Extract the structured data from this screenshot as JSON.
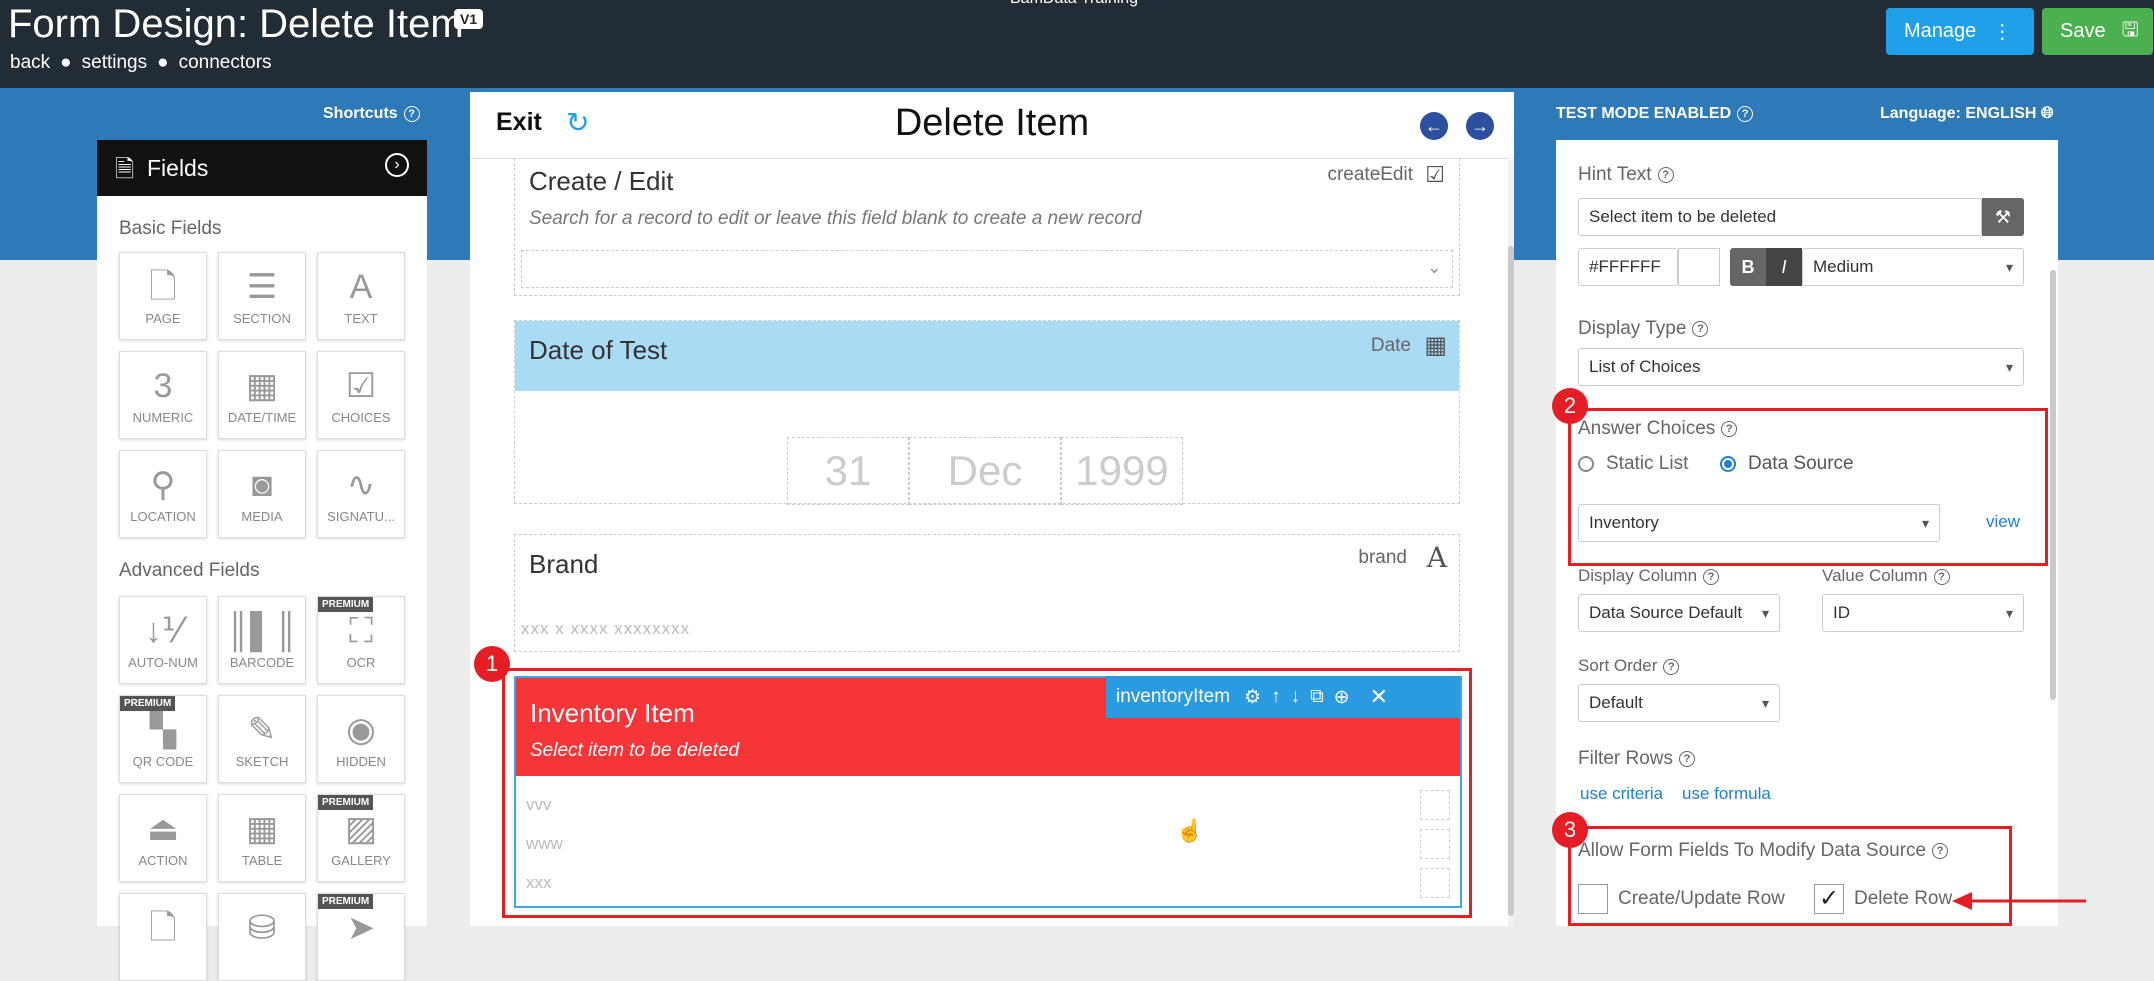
{
  "header": {
    "title": "Form Design: Delete Item",
    "version": "V1",
    "links": [
      "back",
      "settings",
      "connectors"
    ],
    "center_text": "BamData Training",
    "manage_label": "Manage",
    "save_label": "Save"
  },
  "subheader": {
    "shortcuts": "Shortcuts",
    "test_mode": "TEST MODE ENABLED",
    "language": "Language: ENGLISH"
  },
  "fields_panel": {
    "title": "Fields",
    "basic_heading": "Basic Fields",
    "advanced_heading": "Advanced Fields",
    "premium_label": "PREMIUM",
    "basic": [
      {
        "label": "PAGE",
        "icon": "page-icon",
        "glyph": "🗋"
      },
      {
        "label": "SECTION",
        "icon": "section-icon",
        "glyph": "☰"
      },
      {
        "label": "TEXT",
        "icon": "text-icon",
        "glyph": "A"
      },
      {
        "label": "NUMERIC",
        "icon": "numeric-icon",
        "glyph": "3"
      },
      {
        "label": "DATE/TIME",
        "icon": "calendar-icon",
        "glyph": "▦"
      },
      {
        "label": "CHOICES",
        "icon": "checkbox-icon",
        "glyph": "☑"
      },
      {
        "label": "LOCATION",
        "icon": "location-pin-icon",
        "glyph": "⚲"
      },
      {
        "label": "MEDIA",
        "icon": "camera-icon",
        "glyph": "◙"
      },
      {
        "label": "SIGNATU...",
        "icon": "signature-icon",
        "glyph": "∿"
      }
    ],
    "advanced": [
      {
        "label": "AUTO-NUM",
        "icon": "auto-number-icon",
        "glyph": "↓⅟"
      },
      {
        "label": "BARCODE",
        "icon": "barcode-icon",
        "glyph": "║▌║"
      },
      {
        "label": "OCR",
        "icon": "ocr-icon",
        "glyph": "⛶",
        "premium": true
      },
      {
        "label": "QR CODE",
        "icon": "qr-code-icon",
        "glyph": "▚",
        "premium": true
      },
      {
        "label": "SKETCH",
        "icon": "pencil-icon",
        "glyph": "✎"
      },
      {
        "label": "HIDDEN",
        "icon": "eye-slash-icon",
        "glyph": "◉"
      },
      {
        "label": "ACTION",
        "icon": "action-icon",
        "glyph": "⏏"
      },
      {
        "label": "TABLE",
        "icon": "table-icon",
        "glyph": "▦"
      },
      {
        "label": "GALLERY",
        "icon": "gallery-icon",
        "glyph": "▨",
        "premium": true
      },
      {
        "label": "",
        "icon": "document-icon",
        "glyph": "🗋"
      },
      {
        "label": "",
        "icon": "database-icon",
        "glyph": "⛁"
      },
      {
        "label": "",
        "icon": "send-icon",
        "glyph": "➤",
        "premium": true
      }
    ]
  },
  "canvas": {
    "exit_label": "Exit",
    "title": "Delete Item",
    "fields": {
      "create_edit": {
        "label": "Create / Edit",
        "type": "createEdit",
        "hint": "Search for a record to edit or leave this field blank to create a new record"
      },
      "date": {
        "label": "Date of Test",
        "type": "Date",
        "day": "31",
        "month": "Dec",
        "year": "1999"
      },
      "brand": {
        "label": "Brand",
        "type": "brand",
        "placeholder": "xxx x xxxx xxxxxxxx"
      },
      "inventory": {
        "label": "Inventory Item",
        "type": "inventoryItem",
        "hint": "Select item to be deleted",
        "rows": [
          "vvv",
          "www",
          "xxx"
        ]
      }
    }
  },
  "right_panel": {
    "hint_text_label": "Hint Text",
    "hint_text_value": "Select item to be deleted",
    "color_value": "#FFFFFF",
    "bold": "B",
    "italic": "I",
    "size": "Medium",
    "display_type_label": "Display Type",
    "display_type_value": "List of Choices",
    "answer_choices_label": "Answer Choices",
    "static_list": "Static List",
    "data_source": "Data Source",
    "data_source_value": "Inventory",
    "view_link": "view",
    "display_column_label": "Display Column",
    "display_column_value": "Data Source Default",
    "value_column_label": "Value Column",
    "value_column_value": "ID",
    "sort_order_label": "Sort Order",
    "sort_order_value": "Default",
    "filter_rows_label": "Filter Rows",
    "use_criteria": "use criteria",
    "use_formula": "use formula",
    "allow_modify_label": "Allow Form Fields To Modify Data Source",
    "create_update_row": "Create/Update Row",
    "delete_row": "Delete Row",
    "create_update_checked": false,
    "delete_row_checked": true
  },
  "annotations": [
    "1",
    "2",
    "3"
  ],
  "colors": {
    "header_bg": "#222c35",
    "band_blue": "#2e7ab8",
    "manage_blue": "#1fa0e8",
    "save_green": "#4caf50",
    "date_field_bg": "#a9dcf4",
    "inventory_red": "#f53538",
    "annotation_red": "#e51e25"
  }
}
